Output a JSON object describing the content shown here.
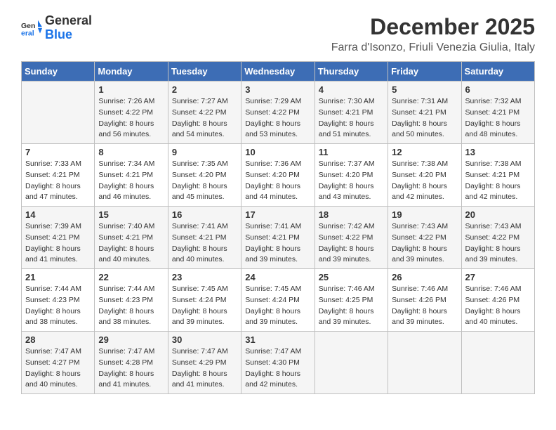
{
  "logo": {
    "line1": "General",
    "line2": "Blue"
  },
  "header": {
    "month": "December 2025",
    "location": "Farra d'Isonzo, Friuli Venezia Giulia, Italy"
  },
  "weekdays": [
    "Sunday",
    "Monday",
    "Tuesday",
    "Wednesday",
    "Thursday",
    "Friday",
    "Saturday"
  ],
  "weeks": [
    [
      {
        "day": "",
        "sunrise": "",
        "sunset": "",
        "daylight": ""
      },
      {
        "day": "1",
        "sunrise": "7:26 AM",
        "sunset": "4:22 PM",
        "daylight": "8 hours and 56 minutes."
      },
      {
        "day": "2",
        "sunrise": "7:27 AM",
        "sunset": "4:22 PM",
        "daylight": "8 hours and 54 minutes."
      },
      {
        "day": "3",
        "sunrise": "7:29 AM",
        "sunset": "4:22 PM",
        "daylight": "8 hours and 53 minutes."
      },
      {
        "day": "4",
        "sunrise": "7:30 AM",
        "sunset": "4:21 PM",
        "daylight": "8 hours and 51 minutes."
      },
      {
        "day": "5",
        "sunrise": "7:31 AM",
        "sunset": "4:21 PM",
        "daylight": "8 hours and 50 minutes."
      },
      {
        "day": "6",
        "sunrise": "7:32 AM",
        "sunset": "4:21 PM",
        "daylight": "8 hours and 48 minutes."
      }
    ],
    [
      {
        "day": "7",
        "sunrise": "7:33 AM",
        "sunset": "4:21 PM",
        "daylight": "8 hours and 47 minutes."
      },
      {
        "day": "8",
        "sunrise": "7:34 AM",
        "sunset": "4:21 PM",
        "daylight": "8 hours and 46 minutes."
      },
      {
        "day": "9",
        "sunrise": "7:35 AM",
        "sunset": "4:20 PM",
        "daylight": "8 hours and 45 minutes."
      },
      {
        "day": "10",
        "sunrise": "7:36 AM",
        "sunset": "4:20 PM",
        "daylight": "8 hours and 44 minutes."
      },
      {
        "day": "11",
        "sunrise": "7:37 AM",
        "sunset": "4:20 PM",
        "daylight": "8 hours and 43 minutes."
      },
      {
        "day": "12",
        "sunrise": "7:38 AM",
        "sunset": "4:20 PM",
        "daylight": "8 hours and 42 minutes."
      },
      {
        "day": "13",
        "sunrise": "7:38 AM",
        "sunset": "4:21 PM",
        "daylight": "8 hours and 42 minutes."
      }
    ],
    [
      {
        "day": "14",
        "sunrise": "7:39 AM",
        "sunset": "4:21 PM",
        "daylight": "8 hours and 41 minutes."
      },
      {
        "day": "15",
        "sunrise": "7:40 AM",
        "sunset": "4:21 PM",
        "daylight": "8 hours and 40 minutes."
      },
      {
        "day": "16",
        "sunrise": "7:41 AM",
        "sunset": "4:21 PM",
        "daylight": "8 hours and 40 minutes."
      },
      {
        "day": "17",
        "sunrise": "7:41 AM",
        "sunset": "4:21 PM",
        "daylight": "8 hours and 39 minutes."
      },
      {
        "day": "18",
        "sunrise": "7:42 AM",
        "sunset": "4:22 PM",
        "daylight": "8 hours and 39 minutes."
      },
      {
        "day": "19",
        "sunrise": "7:43 AM",
        "sunset": "4:22 PM",
        "daylight": "8 hours and 39 minutes."
      },
      {
        "day": "20",
        "sunrise": "7:43 AM",
        "sunset": "4:22 PM",
        "daylight": "8 hours and 39 minutes."
      }
    ],
    [
      {
        "day": "21",
        "sunrise": "7:44 AM",
        "sunset": "4:23 PM",
        "daylight": "8 hours and 38 minutes."
      },
      {
        "day": "22",
        "sunrise": "7:44 AM",
        "sunset": "4:23 PM",
        "daylight": "8 hours and 38 minutes."
      },
      {
        "day": "23",
        "sunrise": "7:45 AM",
        "sunset": "4:24 PM",
        "daylight": "8 hours and 39 minutes."
      },
      {
        "day": "24",
        "sunrise": "7:45 AM",
        "sunset": "4:24 PM",
        "daylight": "8 hours and 39 minutes."
      },
      {
        "day": "25",
        "sunrise": "7:46 AM",
        "sunset": "4:25 PM",
        "daylight": "8 hours and 39 minutes."
      },
      {
        "day": "26",
        "sunrise": "7:46 AM",
        "sunset": "4:26 PM",
        "daylight": "8 hours and 39 minutes."
      },
      {
        "day": "27",
        "sunrise": "7:46 AM",
        "sunset": "4:26 PM",
        "daylight": "8 hours and 40 minutes."
      }
    ],
    [
      {
        "day": "28",
        "sunrise": "7:47 AM",
        "sunset": "4:27 PM",
        "daylight": "8 hours and 40 minutes."
      },
      {
        "day": "29",
        "sunrise": "7:47 AM",
        "sunset": "4:28 PM",
        "daylight": "8 hours and 41 minutes."
      },
      {
        "day": "30",
        "sunrise": "7:47 AM",
        "sunset": "4:29 PM",
        "daylight": "8 hours and 41 minutes."
      },
      {
        "day": "31",
        "sunrise": "7:47 AM",
        "sunset": "4:30 PM",
        "daylight": "8 hours and 42 minutes."
      },
      {
        "day": "",
        "sunrise": "",
        "sunset": "",
        "daylight": ""
      },
      {
        "day": "",
        "sunrise": "",
        "sunset": "",
        "daylight": ""
      },
      {
        "day": "",
        "sunrise": "",
        "sunset": "",
        "daylight": ""
      }
    ]
  ]
}
